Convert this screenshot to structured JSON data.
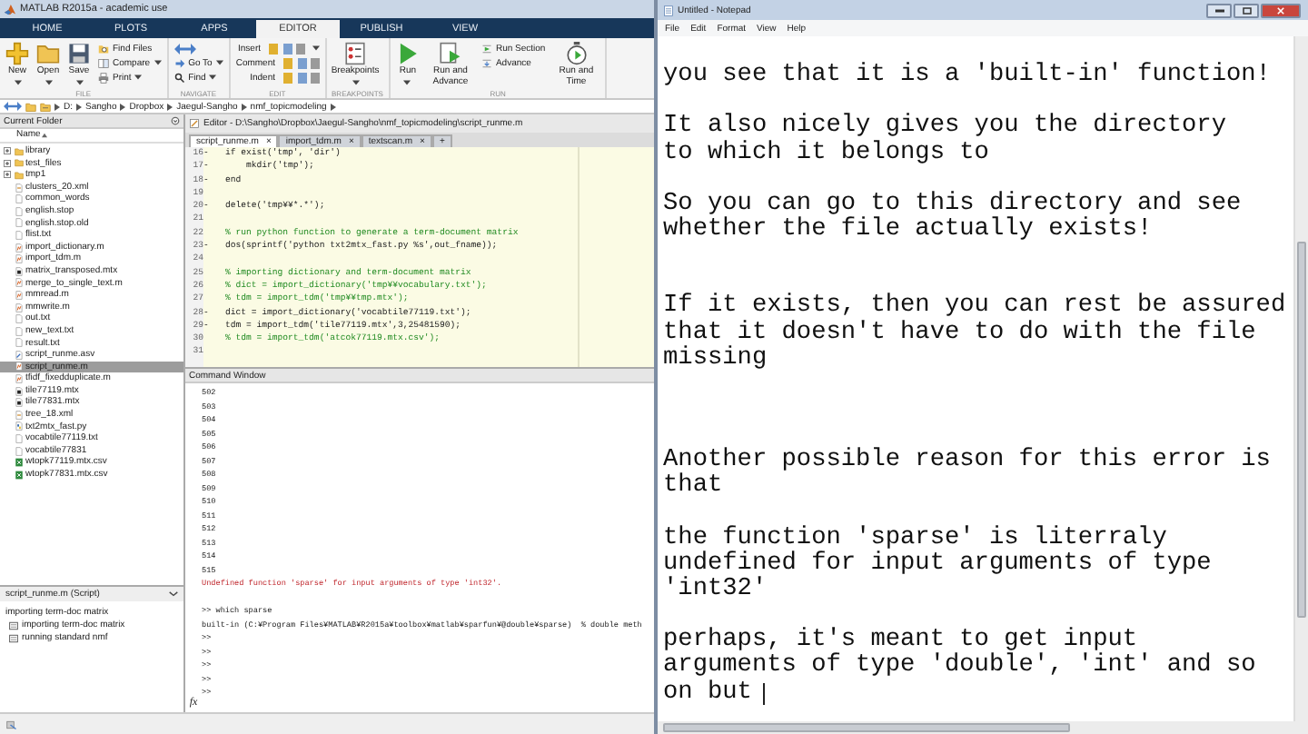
{
  "matlab": {
    "title": "MATLAB R2015a - academic use",
    "tabs": [
      {
        "label": "HOME",
        "selected": false
      },
      {
        "label": "PLOTS",
        "selected": false
      },
      {
        "label": "APPS",
        "selected": false
      },
      {
        "label": "EDITOR",
        "selected": true
      },
      {
        "label": "PUBLISH",
        "selected": false
      },
      {
        "label": "VIEW",
        "selected": false
      }
    ],
    "toolstrip": [
      {
        "title": "FILE",
        "items": [
          {
            "kind": "large",
            "label": "New",
            "menu": true
          },
          {
            "kind": "large",
            "label": "Open",
            "menu": true
          },
          {
            "kind": "large",
            "label": "Save",
            "menu": true
          },
          {
            "kind": "stack",
            "rows": [
              {
                "label": "Find Files",
                "menu": false
              },
              {
                "label": "Compare",
                "menu": true
              },
              {
                "label": "Print",
                "menu": true
              }
            ]
          }
        ]
      },
      {
        "title": "NAVIGATE",
        "items": [
          {
            "kind": "stack",
            "rows": [
              {
                "menu": false
              },
              {
                "label": "Go To",
                "menu": true
              },
              {
                "label": "Find",
                "menu": true
              }
            ]
          }
        ]
      },
      {
        "title": "EDIT",
        "items": [
          {
            "kind": "tools",
            "rows": [
              {
                "label": "Insert",
                "menu": true
              },
              {
                "label": "Comment",
                "menu": false
              },
              {
                "label": "Indent",
                "menu": false
              }
            ]
          }
        ]
      },
      {
        "title": "BREAKPOINTS",
        "items": [
          {
            "kind": "large",
            "label": "Breakpoints",
            "menu": true
          }
        ]
      },
      {
        "title": "RUN",
        "items": [
          {
            "kind": "large",
            "label": "Run",
            "menu": true
          },
          {
            "kind": "large",
            "label": "Run and Advance",
            "menu": false
          },
          {
            "kind": "stack",
            "rows": [
              {
                "label": "Run Section",
                "menu": false
              },
              {
                "label": "Advance",
                "menu": false
              }
            ]
          },
          {
            "kind": "large",
            "label": "Run and Time",
            "menu": false
          }
        ]
      }
    ],
    "path": [
      "D:",
      "Sangho",
      "Dropbox",
      "Jaegul-Sangho",
      "nmf_topicmodeling"
    ],
    "current_folder": {
      "title": "Current Folder",
      "column": "Name",
      "files": [
        {
          "name": "library",
          "kind": "folder",
          "expanded": false,
          "selected": false
        },
        {
          "name": "test_files",
          "kind": "folder",
          "expanded": false,
          "selected": false
        },
        {
          "name": "tmp1",
          "kind": "folder",
          "expanded": false,
          "selected": false
        },
        {
          "name": "clusters_20.xml",
          "kind": "xml",
          "selected": false
        },
        {
          "name": "common_words",
          "kind": "text",
          "selected": false
        },
        {
          "name": "english.stop",
          "kind": "text",
          "selected": false
        },
        {
          "name": "english.stop.old",
          "kind": "text",
          "selected": false
        },
        {
          "name": "flist.txt",
          "kind": "text",
          "selected": false
        },
        {
          "name": "import_dictionary.m",
          "kind": "script",
          "selected": false
        },
        {
          "name": "import_tdm.m",
          "kind": "script",
          "selected": false
        },
        {
          "name": "matrix_transposed.mtx",
          "kind": "data",
          "selected": false
        },
        {
          "name": "merge_to_single_text.m",
          "kind": "script",
          "selected": false
        },
        {
          "name": "mmread.m",
          "kind": "script",
          "selected": false
        },
        {
          "name": "mmwrite.m",
          "kind": "script",
          "selected": false
        },
        {
          "name": "out.txt",
          "kind": "text",
          "selected": false
        },
        {
          "name": "new_text.txt",
          "kind": "text",
          "selected": false
        },
        {
          "name": "result.txt",
          "kind": "text",
          "selected": false
        },
        {
          "name": "script_runme.asv",
          "kind": "autosave",
          "selected": false
        },
        {
          "name": "script_runme.m",
          "kind": "script",
          "selected": true
        },
        {
          "name": "tfidf_fixedduplicate.m",
          "kind": "script",
          "selected": false
        },
        {
          "name": "tile77119.mtx",
          "kind": "data",
          "selected": false
        },
        {
          "name": "tile77831.mtx",
          "kind": "data",
          "selected": false
        },
        {
          "name": "tree_18.xml",
          "kind": "xml",
          "selected": false
        },
        {
          "name": "txt2mtx_fast.py",
          "kind": "python",
          "selected": false
        },
        {
          "name": "vocabtile77119.txt",
          "kind": "text",
          "selected": false
        },
        {
          "name": "vocabtile77831",
          "kind": "text",
          "selected": false
        },
        {
          "name": "wtopk77119.mtx.csv",
          "kind": "csv",
          "selected": false
        },
        {
          "name": "wtopk77831.mtx.csv",
          "kind": "csv",
          "selected": false
        }
      ],
      "details": {
        "title": "script_runme.m (Script)",
        "summary": "importing term-doc matrix",
        "items": [
          "importing term-doc matrix",
          "running standard nmf"
        ]
      }
    },
    "editor": {
      "title": "Editor - D:\\Sangho\\Dropbox\\Jaegul-Sangho\\nmf_topicmodeling\\script_runme.m",
      "tabs": [
        {
          "label": "script_runme.m",
          "close": "×",
          "selected": true
        },
        {
          "label": "import_tdm.m",
          "close": "×",
          "selected": false
        },
        {
          "label": "textscan.m",
          "close": "×",
          "selected": false
        }
      ],
      "new_tab": "+",
      "lines": [
        {
          "number": "16",
          "marker": "-",
          "kind": "code",
          "text": "if exist('tmp', 'dir')"
        },
        {
          "number": "17",
          "marker": "-",
          "kind": "code",
          "text": "    mkdir('tmp');"
        },
        {
          "number": "18",
          "marker": "-",
          "kind": "code",
          "text": "end"
        },
        {
          "number": "19",
          "kind": "blank"
        },
        {
          "number": "20",
          "marker": "-",
          "kind": "code",
          "text": "delete('tmp¥¥*.*');"
        },
        {
          "number": "21",
          "kind": "blank"
        },
        {
          "number": "22",
          "kind": "comment",
          "text": "% run python function to generate a term-document matrix"
        },
        {
          "number": "23",
          "marker": "-",
          "kind": "code",
          "text": "dos(sprintf('python txt2mtx_fast.py %s',out_fname));"
        },
        {
          "number": "24",
          "kind": "blank"
        },
        {
          "number": "25",
          "kind": "comment",
          "text": "% importing dictionary and term-document matrix"
        },
        {
          "number": "26",
          "kind": "comment",
          "text": "% dict = import_dictionary('tmp¥¥vocabulary.txt');"
        },
        {
          "number": "27",
          "kind": "comment",
          "text": "% tdm = import_tdm('tmp¥¥tmp.mtx');"
        },
        {
          "number": "28",
          "marker": "-",
          "kind": "code",
          "text": "dict = import_dictionary('vocabtile77119.txt');"
        },
        {
          "number": "29",
          "marker": "-",
          "kind": "code",
          "text": "tdm = import_tdm('tile77119.mtx',3,25481590);"
        },
        {
          "number": "30",
          "kind": "comment",
          "text": "% tdm = import_tdm('atcok77119.mtx.csv');"
        },
        {
          "number": "31",
          "kind": "blank"
        }
      ]
    },
    "command_window": {
      "title": "Command Window",
      "fx": "fx",
      "lines": [
        {
          "kind": "output",
          "text": "502"
        },
        {
          "kind": "output",
          "text": "503"
        },
        {
          "kind": "output",
          "text": "504"
        },
        {
          "kind": "output",
          "text": "505"
        },
        {
          "kind": "output",
          "text": "506"
        },
        {
          "kind": "output",
          "text": "507"
        },
        {
          "kind": "output",
          "text": "508"
        },
        {
          "kind": "output",
          "text": "509"
        },
        {
          "kind": "output",
          "text": "510"
        },
        {
          "kind": "output",
          "text": "511"
        },
        {
          "kind": "output",
          "text": "512"
        },
        {
          "kind": "output",
          "text": "513"
        },
        {
          "kind": "output",
          "text": "514"
        },
        {
          "kind": "output",
          "text": "515"
        },
        {
          "kind": "error",
          "text": "Undefined function 'sparse' for input arguments of type 'int32'."
        },
        {
          "kind": "blank"
        },
        {
          "kind": "prompt",
          "text": ">> which sparse"
        },
        {
          "kind": "output",
          "text": "built-in (C:¥Program Files¥MATLAB¥R2015a¥toolbox¥matlab¥sparfun¥@double¥sparse)  % double meth"
        },
        {
          "kind": "prompt",
          "text": ">>"
        },
        {
          "kind": "prompt",
          "text": ">>"
        },
        {
          "kind": "prompt",
          "text": ">>"
        },
        {
          "kind": "prompt",
          "text": ">>"
        },
        {
          "kind": "prompt",
          "text": ">>"
        }
      ]
    }
  },
  "notepad": {
    "title": "Untitled - Notepad",
    "menu": [
      "File",
      "Edit",
      "Format",
      "View",
      "Help"
    ],
    "lines": [
      {
        "kind": "blank"
      },
      {
        "kind": "text",
        "text": "you see that it is a 'built-in' function!"
      },
      {
        "kind": "blank"
      },
      {
        "kind": "text",
        "text": "It also nicely gives you the directory"
      },
      {
        "kind": "text",
        "text": "to which it belongs to"
      },
      {
        "kind": "blank"
      },
      {
        "kind": "text",
        "text": "So you can go to this directory and see"
      },
      {
        "kind": "text",
        "text": "whether the file actually exists!"
      },
      {
        "kind": "blank"
      },
      {
        "kind": "blank"
      },
      {
        "kind": "text",
        "text": "If it exists, then you can rest be assured"
      },
      {
        "kind": "text",
        "text": "that it doesn't have to do with the file"
      },
      {
        "kind": "text",
        "text": "missing"
      },
      {
        "kind": "blank"
      },
      {
        "kind": "blank"
      },
      {
        "kind": "blank"
      },
      {
        "kind": "text",
        "text": "Another possible reason for this error is"
      },
      {
        "kind": "text",
        "text": "that"
      },
      {
        "kind": "blank"
      },
      {
        "kind": "text",
        "text": "the function 'sparse' is literraly"
      },
      {
        "kind": "text",
        "text": "undefined for input arguments of type"
      },
      {
        "kind": "text",
        "text": "'int32'"
      },
      {
        "kind": "blank"
      },
      {
        "kind": "text",
        "text": "perhaps, it's meant to get input"
      },
      {
        "kind": "text",
        "text": "arguments of type 'double', 'int' and so"
      },
      {
        "kind": "text",
        "text": "on but",
        "caret": true
      }
    ]
  }
}
